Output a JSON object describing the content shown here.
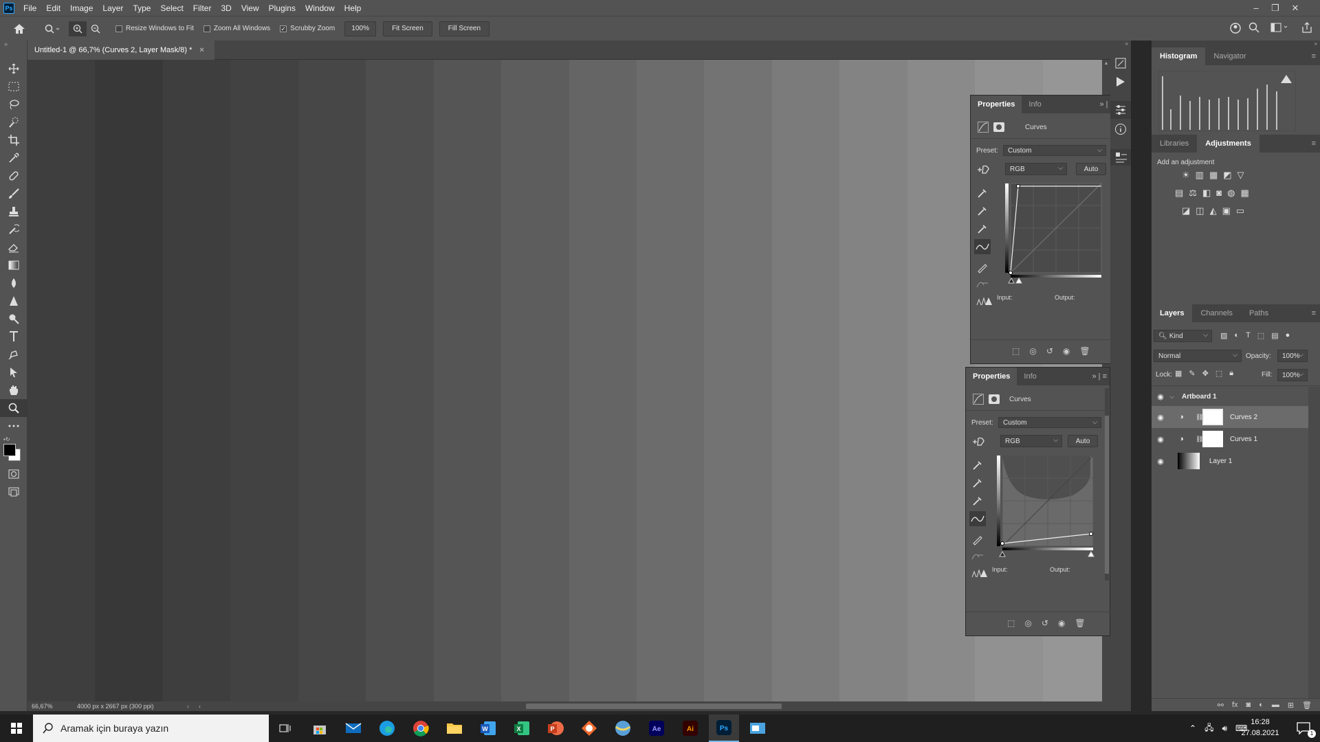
{
  "menu": [
    "File",
    "Edit",
    "Image",
    "Layer",
    "Type",
    "Select",
    "Filter",
    "3D",
    "View",
    "Plugins",
    "Window",
    "Help"
  ],
  "options": {
    "resize_windows": "Resize Windows to Fit",
    "zoom_all": "Zoom All Windows",
    "scrubby": "Scrubby Zoom",
    "zoom_pct": "100%",
    "fit_screen": "Fit Screen",
    "fill_screen": "Fill Screen"
  },
  "document": {
    "tab_title": "Untitled-1 @ 66,7% (Curves 2, Layer Mask/8) *",
    "zoom": "66,67%",
    "info": "4000 px x 2667 px (300 ppi)"
  },
  "canvas_colors": [
    "#3e3e3e",
    "#383838",
    "#3e3e3e",
    "#424242",
    "#474747",
    "#4e4e4e",
    "#555555",
    "#5d5d5d",
    "#656565",
    "#6c6c6c",
    "#737373",
    "#7b7b7b",
    "#838383",
    "#8a8a8a",
    "#919191",
    "#969696"
  ],
  "panel_top": {
    "tab1": "Histogram",
    "tab2": "Navigator"
  },
  "panel_mid": {
    "tab1": "Libraries",
    "tab2": "Adjustments",
    "add_label": "Add an adjustment"
  },
  "props1": {
    "tab1": "Properties",
    "tab2": "Info",
    "title": "Curves",
    "preset_label": "Preset:",
    "preset": "Custom",
    "channel": "RGB",
    "auto": "Auto",
    "input": "Input:",
    "output": "Output:"
  },
  "props2": {
    "tab1": "Properties",
    "tab2": "Info",
    "title": "Curves",
    "preset_label": "Preset:",
    "preset": "Custom",
    "channel": "RGB",
    "auto": "Auto",
    "input": "Input:",
    "output": "Output:"
  },
  "layers": {
    "tab1": "Layers",
    "tab2": "Channels",
    "tab3": "Paths",
    "kind": "Kind",
    "blend": "Normal",
    "opacity_label": "Opacity:",
    "opacity": "100%",
    "lock_label": "Lock:",
    "fill_label": "Fill:",
    "fill": "100%",
    "items": [
      {
        "name": "Artboard 1"
      },
      {
        "name": "Curves 2"
      },
      {
        "name": "Curves 1"
      },
      {
        "name": "Layer 1"
      }
    ]
  },
  "taskbar": {
    "search_placeholder": "Aramak için buraya yazın",
    "time": "16:28",
    "date": "27.08.2021",
    "notif": "1"
  }
}
